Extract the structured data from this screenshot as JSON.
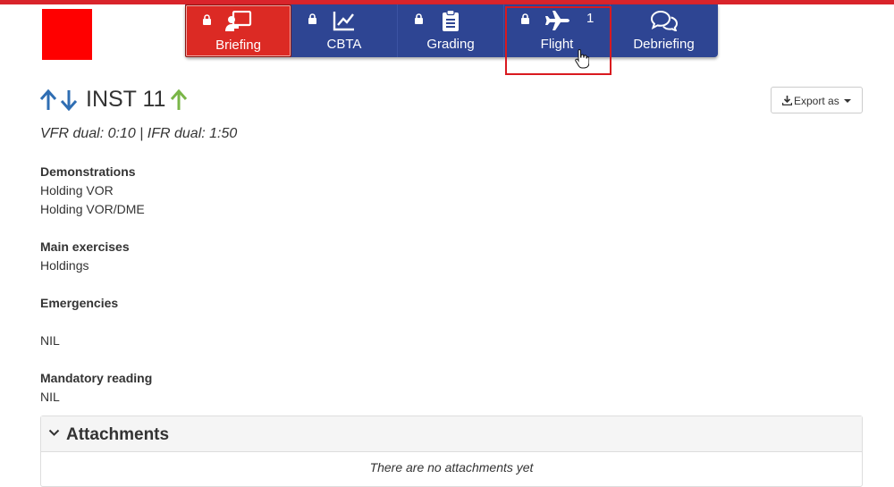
{
  "brand": {
    "logo_color": "#ff0000",
    "accent": "#d9242b",
    "nav_bg": "#2e4593"
  },
  "tabs": [
    {
      "label": "Briefing",
      "icon": "presentation-icon",
      "locked": true,
      "active": true
    },
    {
      "label": "CBTA",
      "icon": "chart-line-icon",
      "locked": true
    },
    {
      "label": "Grading",
      "icon": "clipboard-icon",
      "locked": true
    },
    {
      "label": "Flight",
      "icon": "plane-icon",
      "locked": true,
      "count": "1"
    },
    {
      "label": "Debriefing",
      "icon": "comments-icon",
      "locked": false
    }
  ],
  "lesson": {
    "title": "INST 11",
    "duration": "VFR dual: 0:10 | IFR dual: 1:50"
  },
  "export": {
    "label": "Export as"
  },
  "sections": {
    "demonstrations": {
      "heading": "Demonstrations",
      "items": [
        "Holding VOR",
        "Holding VOR/DME"
      ]
    },
    "main_exercises": {
      "heading": "Main exercises",
      "items": [
        "Holdings"
      ]
    },
    "emergencies": {
      "heading": "Emergencies",
      "items": [
        "NIL"
      ]
    },
    "mandatory_reading": {
      "heading": "Mandatory reading",
      "items": [
        "NIL"
      ]
    }
  },
  "attachments": {
    "title": "Attachments",
    "empty_text": "There are no attachments yet"
  }
}
